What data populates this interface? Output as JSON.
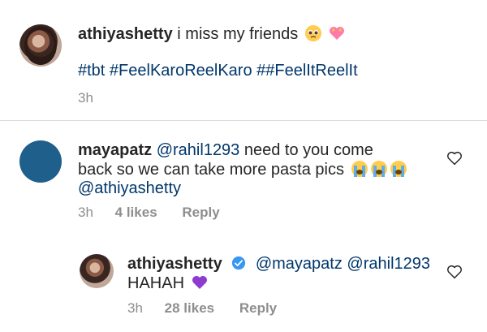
{
  "post": {
    "username": "athiyashetty",
    "caption": "i miss my friends",
    "emojis": [
      "pleading-face-emoji",
      "heart-with-ribbon-emoji"
    ],
    "hashtags": "#tbt #FeelKaroReelKaro ##FeelItReelIt",
    "time": "3h"
  },
  "comments": [
    {
      "username": "mayapatz",
      "mention": "@rahil1293",
      "text_line1": "need to you come",
      "text_line2": "back so we can take more pasta pics",
      "emojis": [
        "crying-face-emoji",
        "crying-face-emoji",
        "crying-face-emoji"
      ],
      "mention2": "@athiyashetty",
      "time": "3h",
      "likes": "4 likes",
      "reply_label": "Reply",
      "avatar_color": "#1f5f8b"
    },
    {
      "username": "athiyashetty",
      "verified": true,
      "mentions": "@mayapatz @rahil1293",
      "text": "HAHAH",
      "emoji": "purple-heart-emoji",
      "time": "3h",
      "likes": "28 likes",
      "reply_label": "Reply"
    }
  ],
  "colors": {
    "text": "#262626",
    "link": "#00376b",
    "meta": "#8e8e8e",
    "divider": "#dbdbdb",
    "verified": "#3897f0",
    "purple_heart": "#8e3ccf"
  }
}
